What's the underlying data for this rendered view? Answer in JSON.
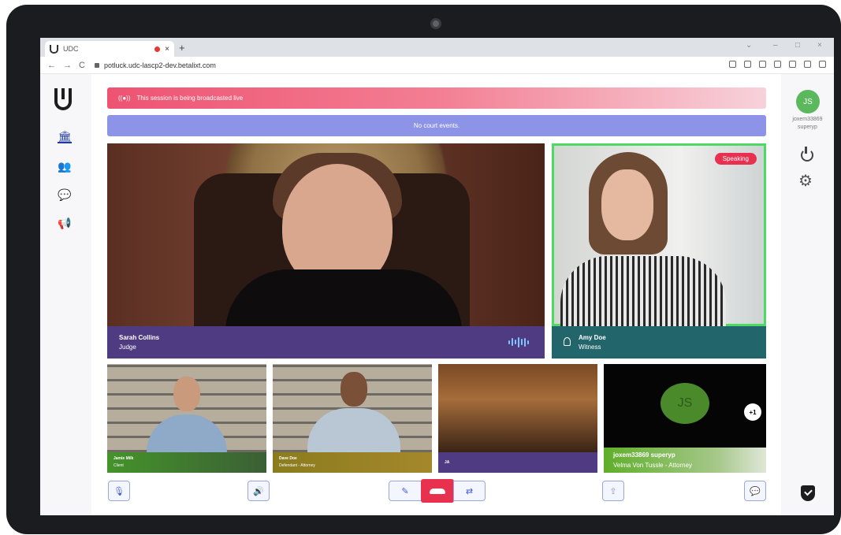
{
  "browser": {
    "tab_title": "UDC",
    "tab_close": "×",
    "new_tab": "+",
    "url": "potluck.udc-lascp2-dev.betalixt.com",
    "nav_back": "←",
    "nav_forward": "→",
    "nav_reload": "C",
    "window_minimize": "–",
    "window_maximize": "□",
    "window_close": "×",
    "window_menu": "⌄"
  },
  "banners": {
    "broadcast_icon": "((●))",
    "broadcast_text": "This session is being broadcasted live",
    "events_text": "No court events."
  },
  "user": {
    "initials": "JS",
    "id": "joxem33869",
    "role": "superyp"
  },
  "participants": {
    "judge": {
      "name": "Sarah Collins",
      "role": "Judge"
    },
    "witness": {
      "name": "Amy Doe",
      "role": "Witness",
      "status": "Speaking"
    },
    "client": {
      "name": "Jamie Milk",
      "role": "Client"
    },
    "defendant": {
      "name": "Dave Doe",
      "role": "Defendant - Attorney"
    },
    "ja": {
      "name": "JA",
      "role": ""
    },
    "joxem": {
      "initials": "JS",
      "name": "joxem33869 superyp",
      "role": "Velma Von Tussle - Attorney",
      "more_count": "+1"
    }
  },
  "icons": {
    "court": "court-icon",
    "people": "people-icon",
    "chat": "chat-icon",
    "megaphone": "megaphone-icon",
    "settings": "⚙",
    "court_glyph": "🏛",
    "people_glyph": "👥",
    "chat_glyph": "💬",
    "megaphone_glyph": "📢",
    "mic_glyph": "🎙",
    "speaker_glyph": "🔊",
    "screen_glyph": "⇪",
    "chat_btn_glyph": "💬",
    "video_off_glyph": "✎",
    "camera_switch_glyph": "⇄"
  },
  "colors": {
    "accent": "#3f5bd6",
    "speaking": "#e8304f",
    "hangup": "#e8304f",
    "speaking_border": "#4cd964"
  }
}
